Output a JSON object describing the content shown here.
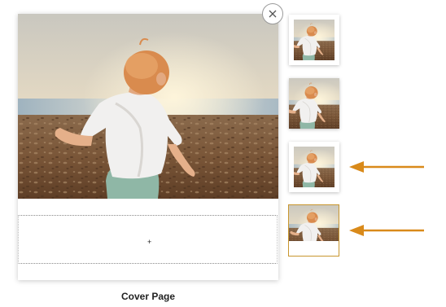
{
  "editor": {
    "page_label": "Cover Page",
    "caption_cursor": "+",
    "close_icon": "close-icon",
    "accent_color": "#d98a1a",
    "selected_border_color": "#c8962e"
  },
  "thumbnails": [
    {
      "name": "thumbnail-page-1",
      "layout": "photo-with-border",
      "selected": false
    },
    {
      "name": "thumbnail-page-2",
      "layout": "full-bleed-photo",
      "selected": false
    },
    {
      "name": "thumbnail-page-3",
      "layout": "photo-with-border",
      "selected": false
    },
    {
      "name": "thumbnail-page-4",
      "layout": "photo-with-caption",
      "selected": true
    }
  ],
  "arrows": [
    {
      "name": "arrow-pointing-thumbnail-3",
      "icon": "arrow-left-icon"
    },
    {
      "name": "arrow-pointing-thumbnail-4",
      "icon": "arrow-left-icon"
    }
  ]
}
